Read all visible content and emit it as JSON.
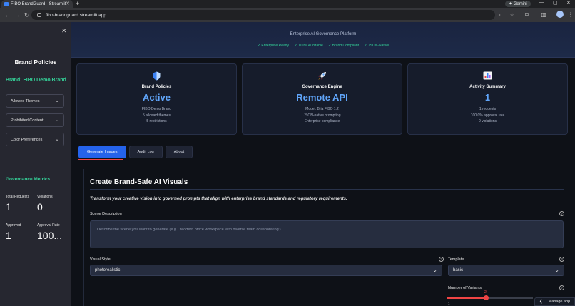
{
  "browser": {
    "tab_title": "FIBO BrandGuard - Streamlit",
    "url": "fibo-brandguard.streamlit.app",
    "gemini_label": "Gemini"
  },
  "sidebar": {
    "title": "Brand Policies",
    "brand_label": "Brand: FIBO Demo Brand",
    "expanders": [
      {
        "label": "Allowed Themes"
      },
      {
        "label": "Prohibited Content"
      },
      {
        "label": "Color Preferences"
      }
    ],
    "metrics_title": "Governance Metrics",
    "metrics": [
      {
        "label": "Total Requests",
        "value": "1"
      },
      {
        "label": "Violations",
        "value": "0"
      },
      {
        "label": "Approved",
        "value": "1"
      },
      {
        "label": "Approval Rate",
        "value": "100..."
      }
    ]
  },
  "header": {
    "subtitle": "Enterprise AI Governance Platform",
    "badges": [
      "✓ Enterprise Ready",
      "✓ 100% Auditable",
      "✓ Brand Compliant",
      "✓ JSON-Native"
    ]
  },
  "cards": [
    {
      "icon": "shield-icon",
      "title": "Brand Policies",
      "value": "Active",
      "lines": [
        "FIBO Demo Brand",
        "5 allowed themes",
        "5 restrictions"
      ]
    },
    {
      "icon": "rocket-icon",
      "title": "Governance Engine",
      "value": "Remote API",
      "lines": [
        "Model: Bria FIBO 1.2",
        "JSON-native prompting",
        "Enterprise compliance"
      ]
    },
    {
      "icon": "bar-chart-icon",
      "title": "Activity Summary",
      "value": "1",
      "lines": [
        "1 requests",
        "100.0% approval rate",
        "0 violations"
      ]
    }
  ],
  "tabs": [
    "Generate Images",
    "Audit Log",
    "About"
  ],
  "content": {
    "title": "Create Brand-Safe AI Visuals",
    "intro": "Transform your creative vision into governed prompts that align with enterprise brand standards and regulatory requirements.",
    "scene_label": "Scene Description",
    "scene_placeholder": "Describe the scene you want to generate (e.g., 'Modern office workspace with diverse team collaborating')",
    "style_label": "Visual Style",
    "style_value": "photorealistic",
    "template_label": "Template",
    "template_value": "basic",
    "variants_label": "Number of Variants",
    "variants_value": "2",
    "variants_min": "1"
  },
  "manage_app": "Manage app",
  "colors": {
    "accent": "#2563eb",
    "green": "#34d399",
    "metric_blue": "#60a5fa",
    "slider": "#ef4444"
  }
}
